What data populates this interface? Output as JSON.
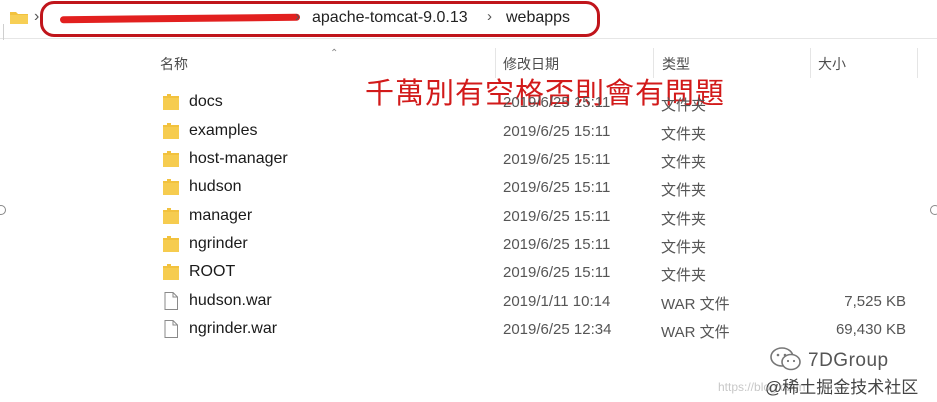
{
  "address_bar": {
    "crumbs": [
      "apache-tomcat-9.0.13",
      "webapps"
    ],
    "separator": "›",
    "highlight_color": "#c0151b"
  },
  "columns": {
    "name": "名称",
    "date": "修改日期",
    "type": "类型",
    "size": "大小"
  },
  "annotation": {
    "text": "千萬別有空格否則會有問題",
    "color": "#d21a1a"
  },
  "files": [
    {
      "name": "docs",
      "date": "2019/6/25 15:11",
      "type": "文件夹",
      "size": "",
      "icon": "folder-icon"
    },
    {
      "name": "examples",
      "date": "2019/6/25 15:11",
      "type": "文件夹",
      "size": "",
      "icon": "folder-icon"
    },
    {
      "name": "host-manager",
      "date": "2019/6/25 15:11",
      "type": "文件夹",
      "size": "",
      "icon": "folder-icon"
    },
    {
      "name": "hudson",
      "date": "2019/6/25 15:11",
      "type": "文件夹",
      "size": "",
      "icon": "folder-icon"
    },
    {
      "name": "manager",
      "date": "2019/6/25 15:11",
      "type": "文件夹",
      "size": "",
      "icon": "folder-icon"
    },
    {
      "name": "ngrinder",
      "date": "2019/6/25 15:11",
      "type": "文件夹",
      "size": "",
      "icon": "folder-icon"
    },
    {
      "name": "ROOT",
      "date": "2019/6/25 15:11",
      "type": "文件夹",
      "size": "",
      "icon": "folder-icon"
    },
    {
      "name": "hudson.war",
      "date": "2019/1/11 10:14",
      "type": "WAR 文件",
      "size": "7,525 KB",
      "icon": "file-icon"
    },
    {
      "name": "ngrinder.war",
      "date": "2019/6/25 12:34",
      "type": "WAR 文件",
      "size": "69,430 KB",
      "icon": "file-icon"
    }
  ],
  "watermark": {
    "brand": "7DGroup",
    "subtitle": "@稀土掘金技术社区",
    "url": "https://blog.csdn"
  },
  "colors": {
    "folder": "#f2c23e",
    "redaction": "#e2201f"
  }
}
